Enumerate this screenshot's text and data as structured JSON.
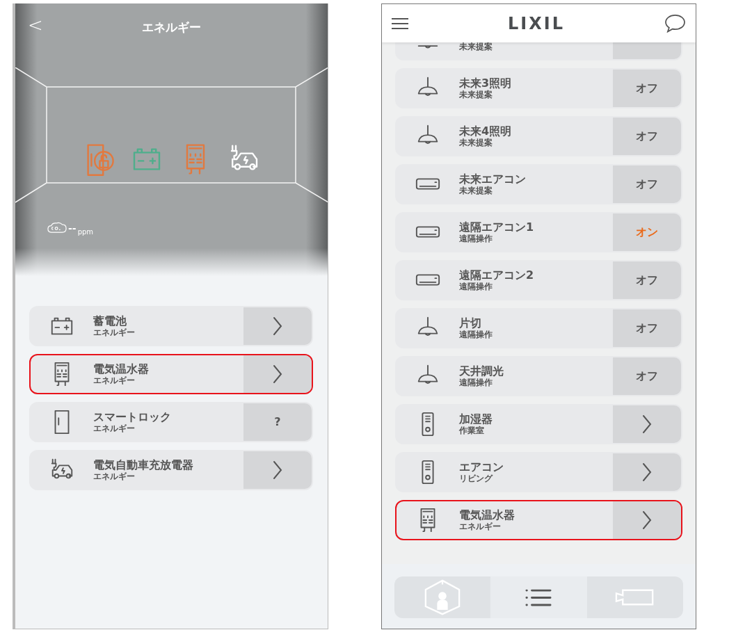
{
  "left_screen": {
    "header": {
      "back": "<",
      "title": "エネルギー"
    },
    "scene": {
      "devices": [
        {
          "kind": "smart_lock",
          "color": "#e2793f"
        },
        {
          "kind": "battery",
          "color": "#4fae8c"
        },
        {
          "kind": "water_heater",
          "color": "#e2793f"
        },
        {
          "kind": "ev_car",
          "color": "#ffffff"
        }
      ],
      "co2": {
        "value": "--",
        "unit": "ppm"
      }
    },
    "devices": [
      {
        "kind": "battery",
        "title": "蓄電池",
        "subtitle": "エネルギー",
        "highlighted": false,
        "action": {
          "kind": "chevron"
        }
      },
      {
        "kind": "water_heater",
        "title": "電気温水器",
        "subtitle": "エネルギー",
        "highlighted": true,
        "action": {
          "kind": "chevron"
        }
      },
      {
        "kind": "door",
        "title": "スマートロック",
        "subtitle": "エネルギー",
        "highlighted": false,
        "action": {
          "kind": "text",
          "label": "?",
          "on": false
        }
      },
      {
        "kind": "ev_car",
        "title": "電気自動車充放電器",
        "subtitle": "エネルギー",
        "highlighted": false,
        "action": {
          "kind": "chevron"
        }
      }
    ]
  },
  "right_screen": {
    "header": {
      "logo": "LIXIL"
    },
    "devices": [
      {
        "kind": "lamp_cut",
        "subtitle": "未来提案",
        "highlighted": false,
        "action": {
          "kind": "none"
        }
      },
      {
        "kind": "lamp",
        "title": "未来3照明",
        "subtitle": "未来提案",
        "highlighted": false,
        "action": {
          "kind": "text",
          "label": "オフ",
          "on": false
        }
      },
      {
        "kind": "lamp",
        "title": "未来4照明",
        "subtitle": "未来提案",
        "highlighted": false,
        "action": {
          "kind": "text",
          "label": "オフ",
          "on": false
        }
      },
      {
        "kind": "aircon",
        "title": "未来エアコン",
        "subtitle": "未来提案",
        "highlighted": false,
        "action": {
          "kind": "text",
          "label": "オフ",
          "on": false
        }
      },
      {
        "kind": "aircon",
        "title": "遠隔エアコン1",
        "subtitle": "遠隔操作",
        "highlighted": false,
        "action": {
          "kind": "text",
          "label": "オン",
          "on": true
        }
      },
      {
        "kind": "aircon",
        "title": "遠隔エアコン2",
        "subtitle": "遠隔操作",
        "highlighted": false,
        "action": {
          "kind": "text",
          "label": "オフ",
          "on": false
        }
      },
      {
        "kind": "lamp",
        "title": "片切",
        "subtitle": "遠隔操作",
        "highlighted": false,
        "action": {
          "kind": "text",
          "label": "オフ",
          "on": false
        }
      },
      {
        "kind": "lamp",
        "title": "天井調光",
        "subtitle": "遠隔操作",
        "highlighted": false,
        "action": {
          "kind": "text",
          "label": "オフ",
          "on": false
        }
      },
      {
        "kind": "remote",
        "title": "加湿器",
        "subtitle": "作業室",
        "highlighted": false,
        "action": {
          "kind": "chevron"
        }
      },
      {
        "kind": "remote",
        "title": "エアコン",
        "subtitle": "リビング",
        "highlighted": false,
        "action": {
          "kind": "chevron"
        }
      },
      {
        "kind": "water_heater",
        "title": "電気温水器",
        "subtitle": "エネルギー",
        "highlighted": true,
        "action": {
          "kind": "chevron"
        }
      }
    ],
    "bottom_nav": [
      {
        "kind": "room",
        "selected": false
      },
      {
        "kind": "list",
        "selected": true
      },
      {
        "kind": "camera",
        "selected": false
      }
    ]
  }
}
